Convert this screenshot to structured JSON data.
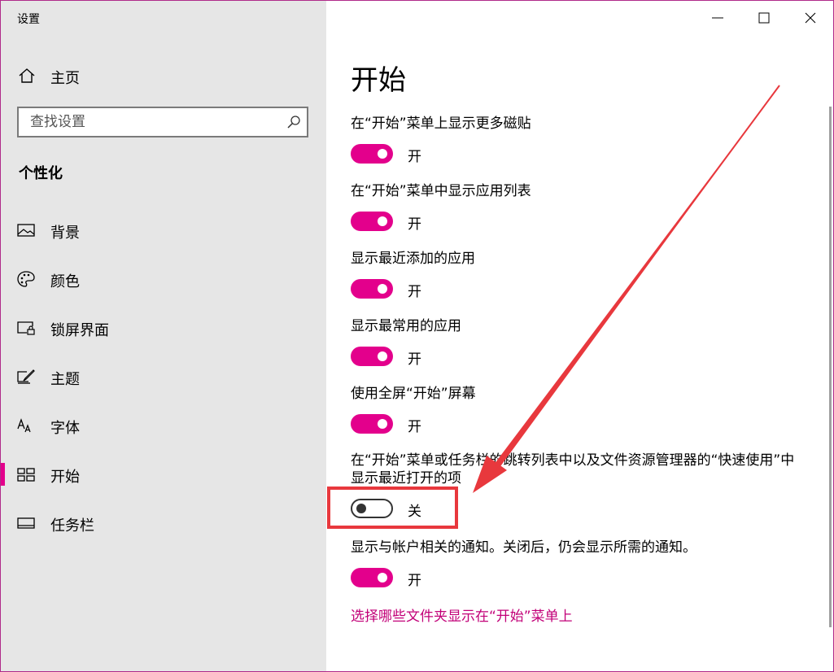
{
  "window": {
    "title": "设置"
  },
  "sidebar": {
    "home_label": "主页",
    "search_placeholder": "查找设置",
    "section": "个性化",
    "items": [
      {
        "label": "背景",
        "icon": "picture-icon"
      },
      {
        "label": "颜色",
        "icon": "palette-icon"
      },
      {
        "label": "锁屏界面",
        "icon": "lock-screen-icon"
      },
      {
        "label": "主题",
        "icon": "theme-icon"
      },
      {
        "label": "字体",
        "icon": "font-icon"
      },
      {
        "label": "开始",
        "icon": "start-icon",
        "active": true
      },
      {
        "label": "任务栏",
        "icon": "taskbar-icon"
      }
    ]
  },
  "main": {
    "title": "开始",
    "settings": [
      {
        "label": "在“开始”菜单上显示更多磁贴",
        "state": "开"
      },
      {
        "label": "在“开始”菜单中显示应用列表",
        "state": "开"
      },
      {
        "label": "显示最近添加的应用",
        "state": "开"
      },
      {
        "label": "显示最常用的应用",
        "state": "开"
      },
      {
        "label": "使用全屏“开始”屏幕",
        "state": "开"
      },
      {
        "label": "在“开始”菜单或任务栏的跳转列表中以及文件资源管理器的“快速使用”中显示最近打开的项",
        "state": "关"
      },
      {
        "label": "显示与帐户相关的通知。关闭后，仍会显示所需的通知。",
        "state": "开"
      }
    ],
    "link": "选择哪些文件夹显示在“开始”菜单上"
  },
  "colors": {
    "accent": "#e3008c",
    "annotation": "#e8383d",
    "sidebar_bg": "#e6e6e6"
  }
}
